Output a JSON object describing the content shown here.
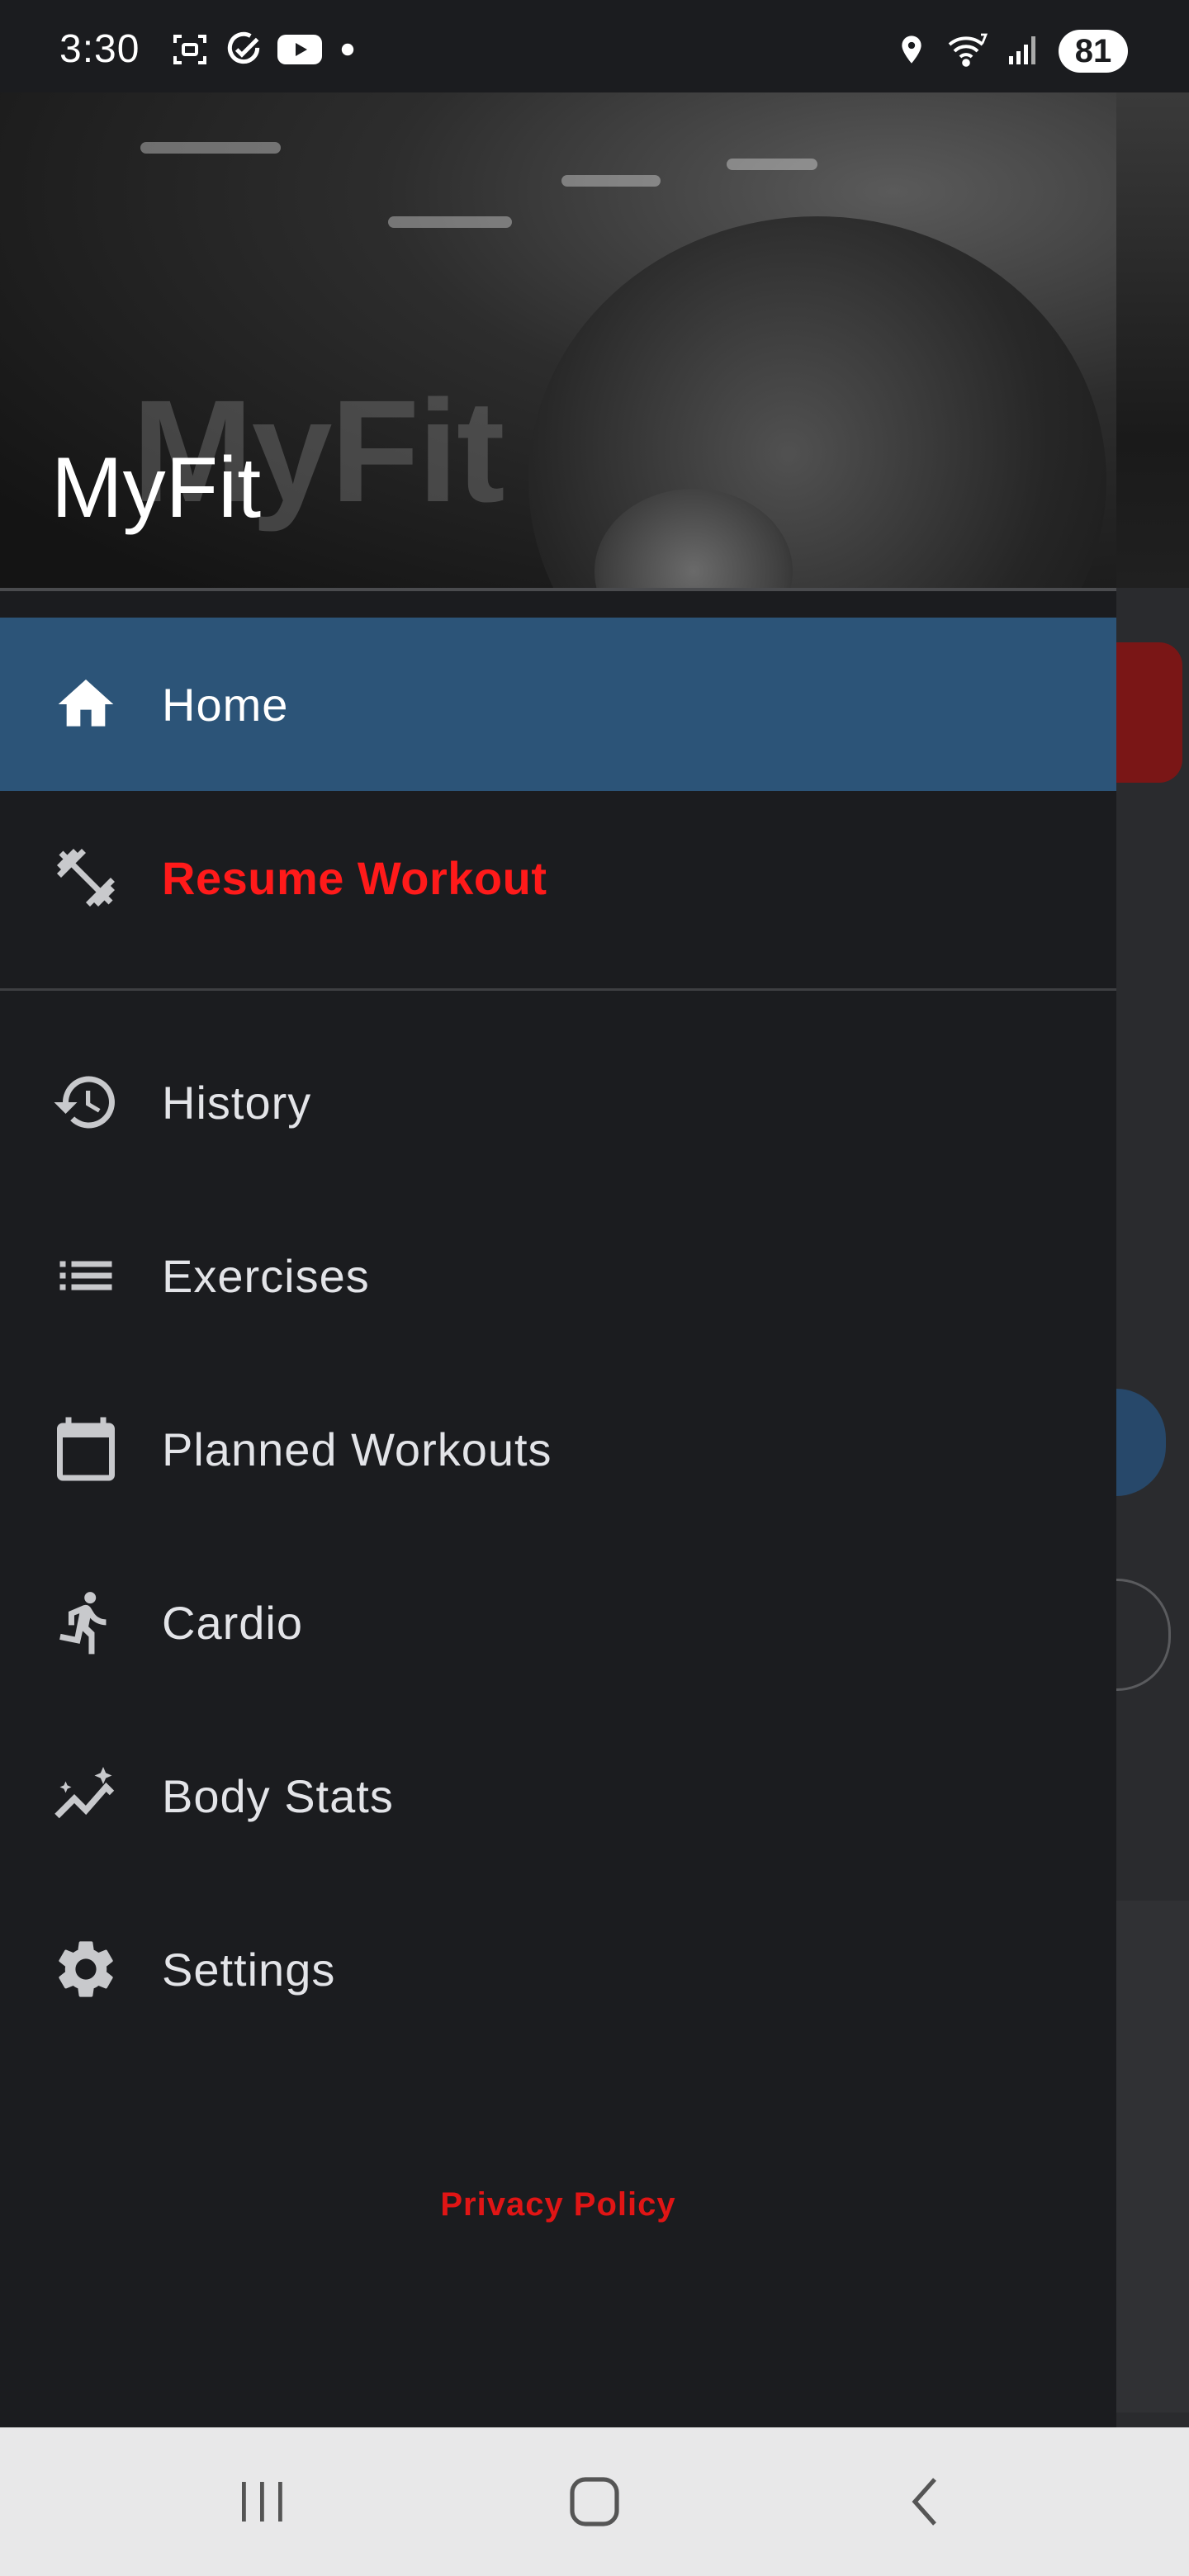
{
  "status_bar": {
    "time": "3:30",
    "battery": "81",
    "left_icons": [
      "screenshot-icon",
      "check-circle-icon",
      "youtube-icon",
      "dot-icon"
    ],
    "right_icons": [
      "location-icon",
      "wifi-icon",
      "signal-icon"
    ]
  },
  "drawer": {
    "app_title": "MyFit",
    "header_watermark": "MyFit",
    "items": [
      {
        "label": "Home",
        "icon": "home-icon",
        "active": true
      },
      {
        "label": "Resume Workout",
        "icon": "dumbbell-icon",
        "color": "#ff1a1a"
      },
      {
        "label": "History",
        "icon": "history-icon"
      },
      {
        "label": "Exercises",
        "icon": "list-icon"
      },
      {
        "label": "Planned Workouts",
        "icon": "calendar-icon"
      },
      {
        "label": "Cardio",
        "icon": "running-icon"
      },
      {
        "label": "Body Stats",
        "icon": "trending-icon"
      },
      {
        "label": "Settings",
        "icon": "gear-icon"
      }
    ],
    "privacy_policy": "Privacy Policy"
  },
  "colors": {
    "background": "#1b1c1f",
    "active_item": "#2c5478",
    "accent_red": "#ff1a1a",
    "nav_bar": "#e8e8e9"
  },
  "system_nav": [
    "recents-button",
    "home-button",
    "back-button"
  ]
}
